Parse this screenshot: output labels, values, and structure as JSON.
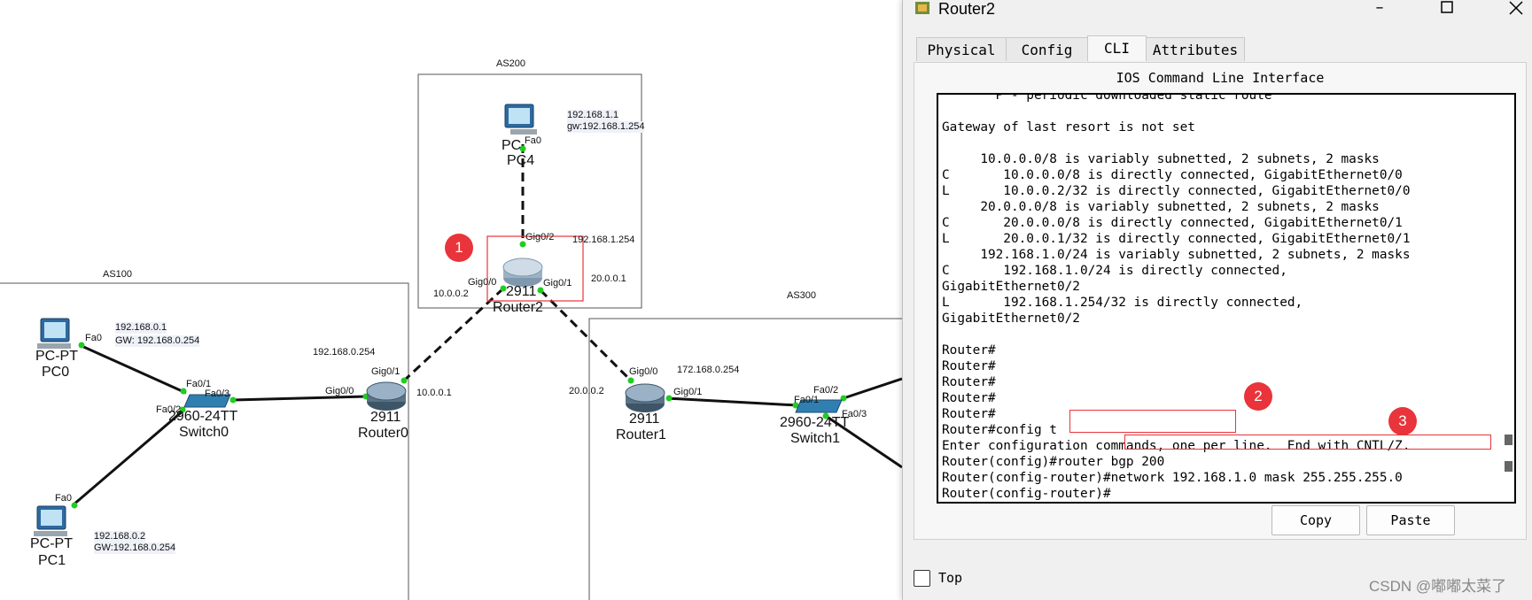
{
  "topology": {
    "as_labels": {
      "as200": "AS200",
      "as100": "AS100",
      "as300": "AS300"
    },
    "devices": {
      "pc4": {
        "type": "PC-PT",
        "name": "PC4",
        "short": "PC",
        "port": "Fa0",
        "ip": "192.168.1.1",
        "gw": "gw:192.168.1.254"
      },
      "router2": {
        "model": "2911",
        "name": "Router2",
        "ports": {
          "gig00": "Gig0/0",
          "gig01": "Gig0/1",
          "gig02": "Gig0/2"
        },
        "ip_left": "10.0.0.2",
        "ip_right": "20.0.0.1",
        "ip_top": "192.168.1.254"
      },
      "pc0": {
        "type": "PC-PT",
        "name": "PC0",
        "port": "Fa0",
        "ip": "192.168.0.1",
        "gw": "GW:  192.168.0.254"
      },
      "pc1": {
        "type": "PC-PT",
        "name": "PC1",
        "port": "Fa0",
        "ip": "192.168.0.2",
        "gw": "GW:192.168.0.254"
      },
      "switch0": {
        "model": "2960-24TT",
        "name": "Switch0",
        "ports": {
          "fa01": "Fa0/1",
          "fa02": "Fa0/2",
          "fa03": "Fa0/3"
        }
      },
      "router0": {
        "model": "2911",
        "name": "Router0",
        "ports": {
          "gig00": "Gig0/0",
          "gig01": "Gig0/1"
        },
        "ip_lan": "192.168.0.254",
        "ip_wan": "10.0.0.1"
      },
      "router1": {
        "model": "2911",
        "name": "Router1",
        "ports": {
          "gig00": "Gig0/0",
          "gig01": "Gig0/1"
        },
        "ip_wan": "20.0.0.2",
        "ip_lan": "172.168.0.254"
      },
      "switch1": {
        "model": "2960-24TT",
        "name": "Switch1",
        "ports": {
          "fa01": "Fa0/1",
          "fa02": "Fa0/2",
          "fa03": "Fa0/3"
        }
      }
    },
    "badges": {
      "b1": "1",
      "b2": "2",
      "b3": "3"
    }
  },
  "window": {
    "title": "Router2",
    "tabs": [
      {
        "label": "Physical"
      },
      {
        "label": "Config"
      },
      {
        "label": "CLI"
      },
      {
        "label": "Attributes"
      }
    ],
    "cli_heading": "IOS Command Line Interface",
    "terminal_lines": [
      "       P - periodic downloaded static route",
      "",
      "Gateway of last resort is not set",
      "",
      "     10.0.0.0/8 is variably subnetted, 2 subnets, 2 masks",
      "C       10.0.0.0/8 is directly connected, GigabitEthernet0/0",
      "L       10.0.0.2/32 is directly connected, GigabitEthernet0/0",
      "     20.0.0.0/8 is variably subnetted, 2 subnets, 2 masks",
      "C       20.0.0.0/8 is directly connected, GigabitEthernet0/1",
      "L       20.0.0.1/32 is directly connected, GigabitEthernet0/1",
      "     192.168.1.0/24 is variably subnetted, 2 subnets, 2 masks",
      "C       192.168.1.0/24 is directly connected,",
      "GigabitEthernet0/2",
      "L       192.168.1.254/32 is directly connected,",
      "GigabitEthernet0/2",
      "",
      "Router#",
      "Router#",
      "Router#",
      "Router#",
      "Router#",
      "Router#config t",
      "Enter configuration commands, one per line.  End with CNTL/Z.",
      "Router(config)#router bgp 200",
      "Router(config-router)#network 192.168.1.0 mask 255.255.255.0",
      "Router(config-router)#"
    ],
    "buttons": {
      "copy": "Copy",
      "paste": "Paste"
    },
    "top_checkbox_label": "Top",
    "top_checked": false
  },
  "watermark": "CSDN @嘟嘟太菜了",
  "colors": {
    "badge": "#e8343a",
    "link_dot": "#22cc22",
    "highlight_box": "#e8343a"
  }
}
